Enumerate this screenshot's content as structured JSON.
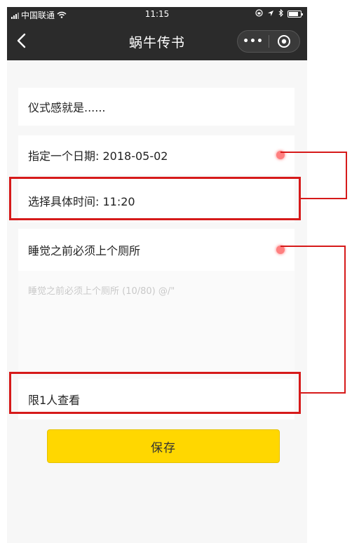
{
  "statusbar": {
    "carrier": "中国联通",
    "time": "11:15"
  },
  "navbar": {
    "title": "蜗牛传书",
    "more_label": "•••"
  },
  "form": {
    "ritual_label": "仪式感就是......",
    "date_label": "指定一个日期: 2018-05-02",
    "time_label": "选择具体时间: 11:20",
    "note_label": "睡觉之前必须上个厕所",
    "note_placeholder": "睡觉之前必须上个厕所 (10/80) @/\"",
    "viewers_label": "限1人查看"
  },
  "actions": {
    "save_label": "保存"
  },
  "colors": {
    "navbar": "#2b2b2b",
    "save_button": "#ffd700",
    "annotation": "#d61a1a",
    "dot": "#ff8080"
  }
}
